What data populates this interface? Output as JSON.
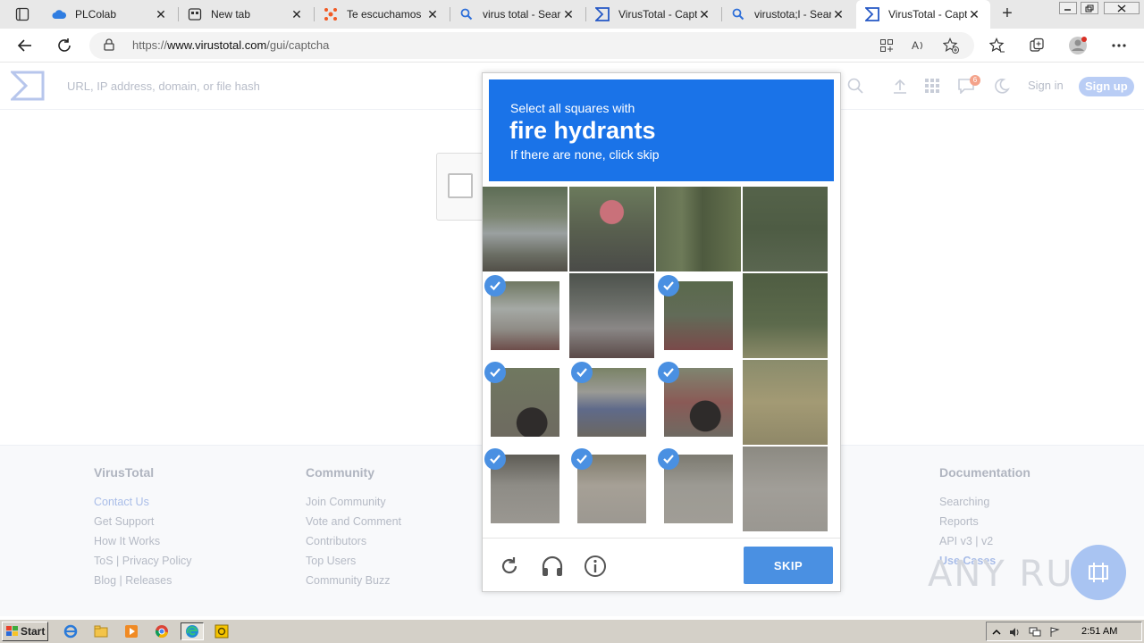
{
  "browser": {
    "tabs": [
      {
        "title": "PLColab",
        "icon": "cloud-icon",
        "active": false
      },
      {
        "title": "New tab",
        "icon": "newtab-icon",
        "active": false
      },
      {
        "title": "Te escuchamos",
        "icon": "form-icon",
        "active": false
      },
      {
        "title": "virus total - Sear",
        "icon": "search-icon",
        "active": false
      },
      {
        "title": "VirusTotal - Capt",
        "icon": "virustotal-icon",
        "active": false
      },
      {
        "title": "virustota;l - Sear",
        "icon": "search-icon",
        "active": false
      },
      {
        "title": "VirusTotal - Capt",
        "icon": "virustotal-icon",
        "active": true
      }
    ],
    "url_prefix": "https://",
    "url_host": "www.virustotal.com",
    "url_path": "/gui/captcha"
  },
  "vt": {
    "search_placeholder": "URL, IP address, domain, or file hash",
    "notif_count": "6",
    "signin": "Sign in",
    "signup": "Sign up"
  },
  "footer": {
    "columns": [
      {
        "heading": "VirusTotal",
        "links": [
          "Contact Us",
          "Get Support",
          "How It Works",
          "ToS | Privacy Policy",
          "Blog | Releases"
        ]
      },
      {
        "heading": "Community",
        "links": [
          "Join Community",
          "Vote and Comment",
          "Contributors",
          "Top Users",
          "Community Buzz"
        ]
      },
      {
        "heading": "Documentation",
        "links": [
          "Searching",
          "Reports",
          "API v3 | v2",
          "Use Cases"
        ]
      }
    ]
  },
  "watermark": "ANY RUN",
  "captcha": {
    "line1": "Select all squares with",
    "target": "fire hydrants",
    "line3": "If there are none, click skip",
    "skip_label": "SKIP",
    "selected": [
      false,
      false,
      false,
      false,
      true,
      false,
      true,
      false,
      true,
      true,
      true,
      false,
      true,
      true,
      true,
      false
    ],
    "colors": {
      "header": "#1a73e8",
      "skip": "#4a90e2",
      "check": "#4a90e2"
    }
  },
  "taskbar": {
    "start_label": "Start",
    "clock": "2:51 AM"
  }
}
